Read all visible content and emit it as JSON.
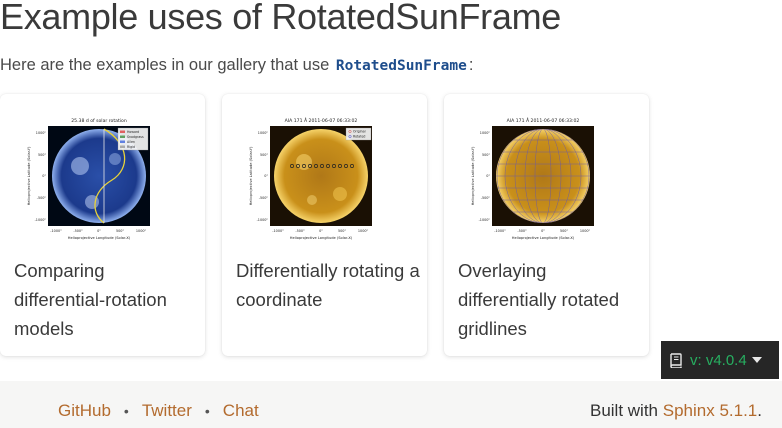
{
  "page": {
    "title": "Example uses of RotatedSunFrame",
    "intro_text": "Here are the examples in our gallery that use",
    "intro_code": "RotatedSunFrame",
    "intro_suffix": ":"
  },
  "cards": [
    {
      "caption": "Comparing differential-rotation models",
      "thumb": {
        "title": "25.38 d of solar rotation",
        "legend": [
          "Howard",
          "Snodgrass",
          "Allen",
          "Rigid"
        ],
        "colors": {
          "disk": "#1c3a8c",
          "glow": "#6a8fd6",
          "curve": "#e8d33a"
        },
        "xlabel": "Helioprojective Longitude (Solar-X)",
        "ylabel": "Helioprojective Latitude (Solar-Y)",
        "xticks": [
          "-1000\"",
          "-500\"",
          "0\"",
          "500\"",
          "1000\""
        ],
        "yticks": [
          "1000\"",
          "500\"",
          "0\"",
          "-500\"",
          "-1000\""
        ]
      }
    },
    {
      "caption": "Differentially rotating a coordinate",
      "thumb": {
        "title": "AIA 171 Å 2011-06-07 06:33:02",
        "legend": [
          "Original",
          "Rotated"
        ],
        "colors": {
          "disk": "#c9901a",
          "glow": "#f2c24a",
          "markers": "#222222"
        },
        "xlabel": "Helioprojective Longitude (Solar-X)",
        "ylabel": "Helioprojective Latitude (Solar-Y)",
        "xticks": [
          "-1000\"",
          "-500\"",
          "0\"",
          "500\"",
          "1000\""
        ],
        "yticks": [
          "1000\"",
          "500\"",
          "0\"",
          "-500\"",
          "-1000\""
        ]
      }
    },
    {
      "caption": "Overlaying differentially rotated gridlines",
      "thumb": {
        "title": "AIA 171 Å 2011-06-07 06:33:02",
        "colors": {
          "disk": "#c9901a",
          "glow": "#f2c24a",
          "grid": "#6a5aa8"
        },
        "xlabel": "Helioprojective Longitude (Solar-X)",
        "ylabel": "Helioprojective Latitude (Solar-Y)",
        "xticks": [
          "-1000\"",
          "-500\"",
          "0\"",
          "500\"",
          "1000\""
        ],
        "yticks": [
          "1000\"",
          "500\"",
          "0\"",
          "-500\"",
          "-1000\""
        ]
      }
    }
  ],
  "version_badge": {
    "label": "v: v4.0.4",
    "icon": "book-icon"
  },
  "footer": {
    "links": [
      "GitHub",
      "Twitter",
      "Chat"
    ],
    "built_prefix": "Built with",
    "built_link": "Sphinx 5.1.1",
    "built_suffix": "."
  }
}
